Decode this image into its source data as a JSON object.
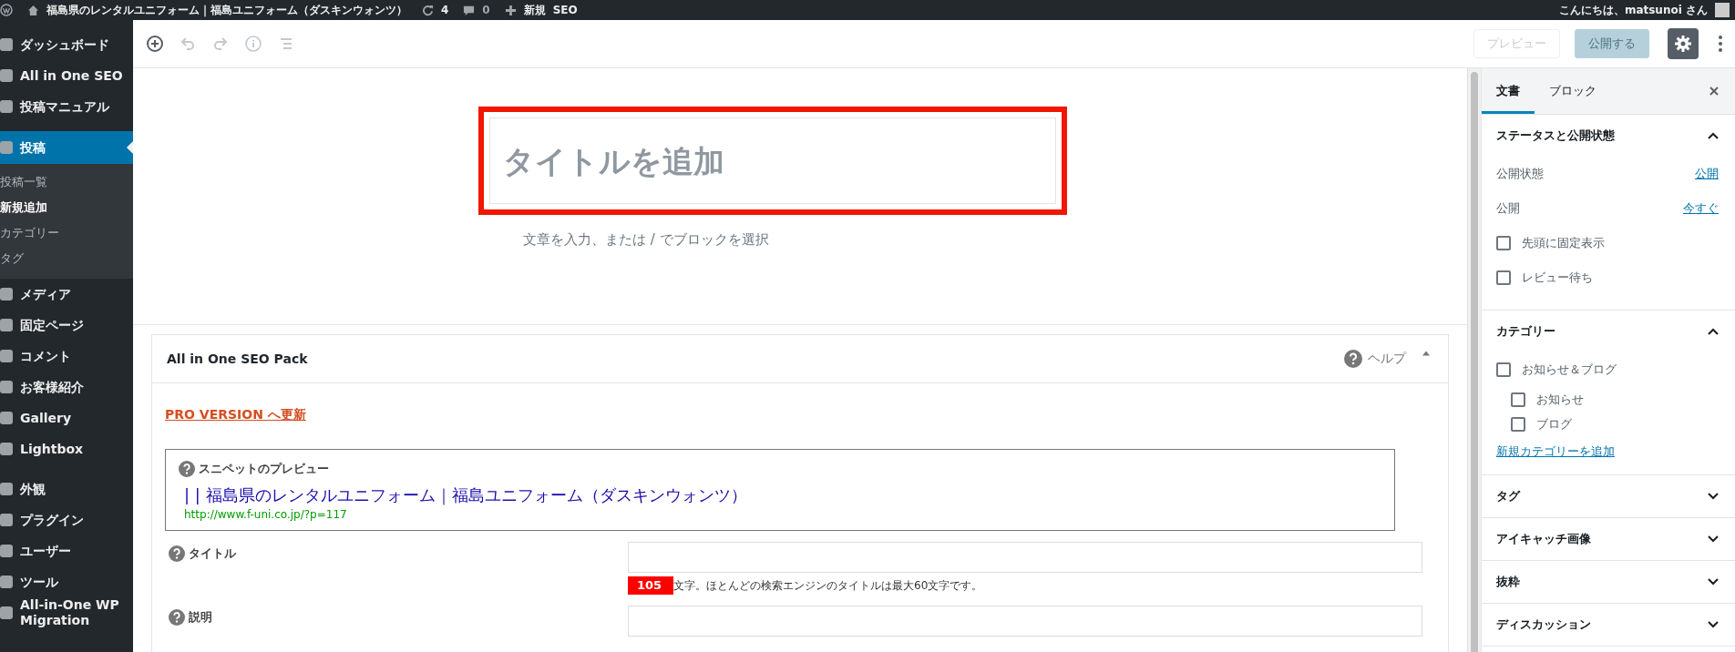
{
  "admin_bar": {
    "site_title": "福島県のレンタルユニフォーム｜福島ユニフォーム（ダスキンウォンツ）",
    "updates": "4",
    "comments": "0",
    "new_label": "新規",
    "seo_label": "SEO",
    "greeting": "こんにちは、matsunoi さん"
  },
  "sidebar": {
    "items": [
      {
        "label": "ダッシュボード",
        "selected": false
      },
      {
        "label": "All in One SEO",
        "selected": false
      },
      {
        "label": "投稿マニュアル",
        "selected": false
      },
      {
        "label": "投稿",
        "selected": true,
        "children": [
          {
            "label": "投稿一覧",
            "selected": false
          },
          {
            "label": "新規追加",
            "selected": true
          },
          {
            "label": "カテゴリー",
            "selected": false
          },
          {
            "label": "タグ",
            "selected": false
          }
        ]
      },
      {
        "label": "メディア",
        "selected": false
      },
      {
        "label": "固定ページ",
        "selected": false
      },
      {
        "label": "コメント",
        "selected": false
      },
      {
        "label": "お客様紹介",
        "selected": false
      },
      {
        "label": "Gallery",
        "selected": false
      },
      {
        "label": "Lightbox",
        "selected": false
      },
      {
        "label": "外観",
        "selected": false
      },
      {
        "label": "プラグイン",
        "selected": false
      },
      {
        "label": "ユーザー",
        "selected": false
      },
      {
        "label": "ツール",
        "selected": false
      },
      {
        "label": "All-in-One WP Migration",
        "selected": false
      }
    ]
  },
  "toolbar": {
    "preview_button": {
      "label": "プレビュー",
      "disabled": true
    },
    "publish_button": {
      "label": "公開する",
      "disabled": true
    }
  },
  "editor": {
    "title_placeholder": "タイトルを追加",
    "body_placeholder": "文章を入力、または / でブロックを選択"
  },
  "seo_panel": {
    "title": "All in One SEO Pack",
    "help": "ヘルプ",
    "pro_link": "PRO VERSION へ更新",
    "snippet": {
      "label": "スニペットのプレビュー",
      "title": "| | 福島県のレンタルユニフォーム｜福島ユニフォーム（ダスキンウォンツ）",
      "url": "http://www.f-uni.co.jp/?p=117"
    },
    "fields": [
      {
        "label": "タイトル",
        "counter": "105",
        "note": "文字。ほとんどの検索エンジンのタイトルは最大60文字です。"
      },
      {
        "label": "説明"
      }
    ]
  },
  "settings_panel": {
    "tabs": [
      {
        "label": "文書",
        "selected": true
      },
      {
        "label": "ブロック",
        "selected": false
      }
    ],
    "sections": [
      {
        "title": "ステータスと公開状態",
        "expanded": true,
        "items": [
          {
            "kind": "setting",
            "label": "公開状態",
            "value": "公開"
          },
          {
            "kind": "setting",
            "label": "公開",
            "value": "今すぐ"
          },
          {
            "kind": "checkbox",
            "label": "先頭に固定表示",
            "checked": false
          },
          {
            "kind": "checkbox",
            "label": "レビュー待ち",
            "checked": false
          }
        ]
      },
      {
        "title": "カテゴリー",
        "expanded": true,
        "items": [
          {
            "kind": "checkbox",
            "label": "お知らせ＆ブログ",
            "checked": false,
            "children": [
              {
                "label": "お知らせ",
                "checked": false
              },
              {
                "label": "ブログ",
                "checked": false
              }
            ]
          },
          {
            "kind": "link",
            "label": "新規カテゴリーを追加"
          }
        ]
      },
      {
        "title": "タグ",
        "expanded": false
      },
      {
        "title": "アイキャッチ画像",
        "expanded": false
      },
      {
        "title": "抜粋",
        "expanded": false
      },
      {
        "title": "ディスカッション",
        "expanded": false
      }
    ]
  }
}
